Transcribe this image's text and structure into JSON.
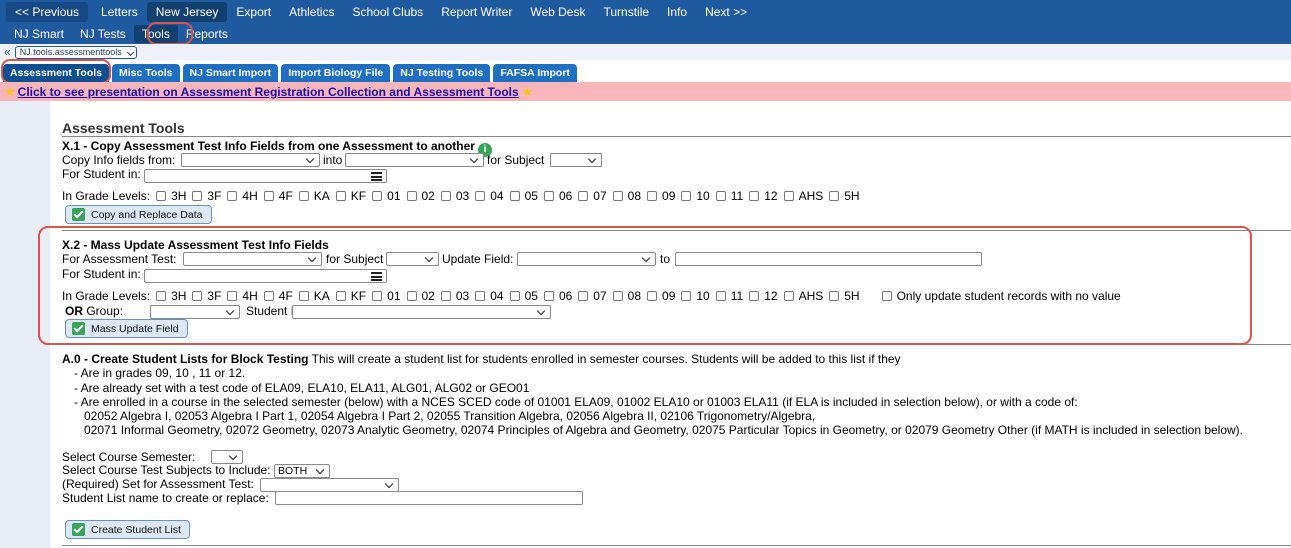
{
  "nav_top": {
    "items": [
      "<< Previous",
      "Letters",
      "New Jersey",
      "Export",
      "Athletics",
      "School Clubs",
      "Report Writer",
      "Web Desk",
      "Turnstile",
      "Info",
      "Next >>"
    ],
    "selected": "New Jersey"
  },
  "nav_sub": {
    "items": [
      "NJ Smart",
      "NJ Tests",
      "Tools",
      "Reports"
    ],
    "selected": "Tools"
  },
  "breadcrumb": {
    "back": "«",
    "value": "NJ.tools.assessmenttools"
  },
  "tabs": [
    "Assessment Tools",
    "Misc Tools",
    "NJ Smart Import",
    "Import Biology File",
    "NJ Testing Tools",
    "FAFSA Import"
  ],
  "banner": {
    "link_text": "Click to see presentation on Assessment Registration Collection and Assessment Tools"
  },
  "page_title": "Assessment Tools",
  "grades": [
    "3H",
    "3F",
    "4H",
    "4F",
    "KA",
    "KF",
    "01",
    "02",
    "03",
    "04",
    "05",
    "06",
    "07",
    "08",
    "09",
    "10",
    "11",
    "12",
    "AHS",
    "5H"
  ],
  "x1": {
    "title": "X.1 - Copy Assessment Test Info Fields from one Assessment to another",
    "copy_from_label": "Copy Info fields from:",
    "into_label": "into",
    "for_subject_label": "for Subject",
    "for_student_label": "For Student in:",
    "grade_levels_label": "In Grade Levels:",
    "button": "Copy and Replace Data"
  },
  "x2": {
    "title": "X.2 - Mass Update Assessment Test Info Fields",
    "for_test_label": "For Assessment Test:",
    "for_subject_label": "for Subject",
    "update_field_label": "Update Field:",
    "to_label": "to",
    "for_student_label": "For Student in:",
    "grade_levels_label": "In Grade Levels:",
    "only_update_label": "Only update student records with no value",
    "or_label": "OR",
    "group_label": "Group:",
    "student_list_label": "Student List:",
    "button": "Mass Update Field"
  },
  "a0": {
    "title": "A.0 - Create Student Lists for Block Testing",
    "intro": "This will create a student list for students enrolled in semester courses. Students will be added to this list if they",
    "bullets": [
      "- Are in grades 09, 10 , 11 or 12.",
      "- Are already set with a test code of ELA09, ELA10, ELA11, ALG01, ALG02 or GEO01",
      "- Are enrolled in a course in the selected semester (below) with a NCES SCED code of 01001 ELA09, 01002 ELA10 or 01003 ELA11 (if ELA is included in selection below), or with a code of:"
    ],
    "codes_line1": "02052 Algebra I, 02053 Algebra I Part 1, 02054 Algebra I Part 2, 02055 Transition Algebra, 02056 Algebra II, 02106 Trigonometry/Algebra,",
    "codes_line2": "02071 Informal Geometry, 02072 Geometry, 02073 Analytic Geometry, 02074 Principles of Algebra and Geometry, 02075 Particular Topics in Geometry, or 02079 Geometry Other (if MATH is included in selection below).",
    "semester_label": "Select Course Semester:",
    "subjects_label": "Select Course Test Subjects to Include:",
    "subjects_value": "BOTH",
    "required_label": "(Required) Set for Assessment Test:",
    "list_name_label": "Student List name to create or replace:",
    "button": "Create Student List"
  }
}
